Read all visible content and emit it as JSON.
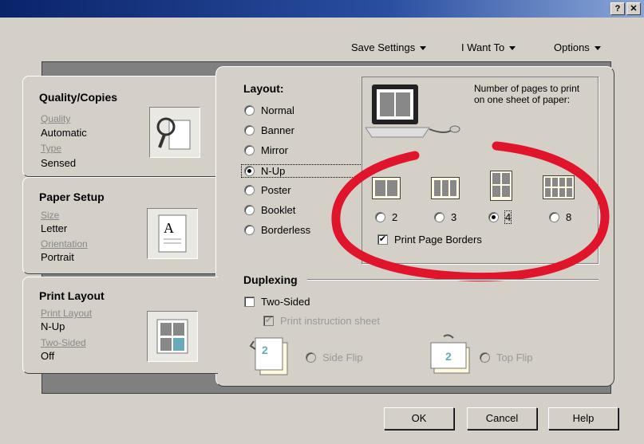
{
  "window": {
    "help_button": "?",
    "close_button": "✕"
  },
  "menu": {
    "save_settings": "Save Settings",
    "i_want_to": "I Want To",
    "options": "Options"
  },
  "tabs": {
    "quality": {
      "title": "Quality/Copies",
      "label1": "Quality",
      "value1": "Automatic",
      "label2": "Type",
      "value2": "Sensed"
    },
    "paper": {
      "title": "Paper Setup",
      "label1": "Size",
      "value1": "Letter",
      "label2": "Orientation",
      "value2": "Portrait"
    },
    "layout": {
      "title": "Print Layout",
      "label1": "Print Layout",
      "value1": "N-Up",
      "label2": "Two-Sided",
      "value2": "Off"
    }
  },
  "layout_section": {
    "heading": "Layout:",
    "options": [
      "Normal",
      "Banner",
      "Mirror",
      "N-Up",
      "Poster",
      "Booklet",
      "Borderless"
    ],
    "selected": "N-Up"
  },
  "nup": {
    "description": "Number of pages to print on one sheet of paper:",
    "options": [
      "2",
      "3",
      "4",
      "8"
    ],
    "selected": "4",
    "print_borders": "Print Page Borders",
    "print_borders_checked": true
  },
  "duplex": {
    "heading": "Duplexing",
    "two_sided": "Two-Sided",
    "instruction": "Print instruction sheet",
    "side_flip": "Side Flip",
    "top_flip": "Top Flip"
  },
  "buttons": {
    "ok": "OK",
    "cancel": "Cancel",
    "help": "Help"
  },
  "colors": {
    "highlight_ring": "#e0142a",
    "title_bar": "#0a246a"
  }
}
